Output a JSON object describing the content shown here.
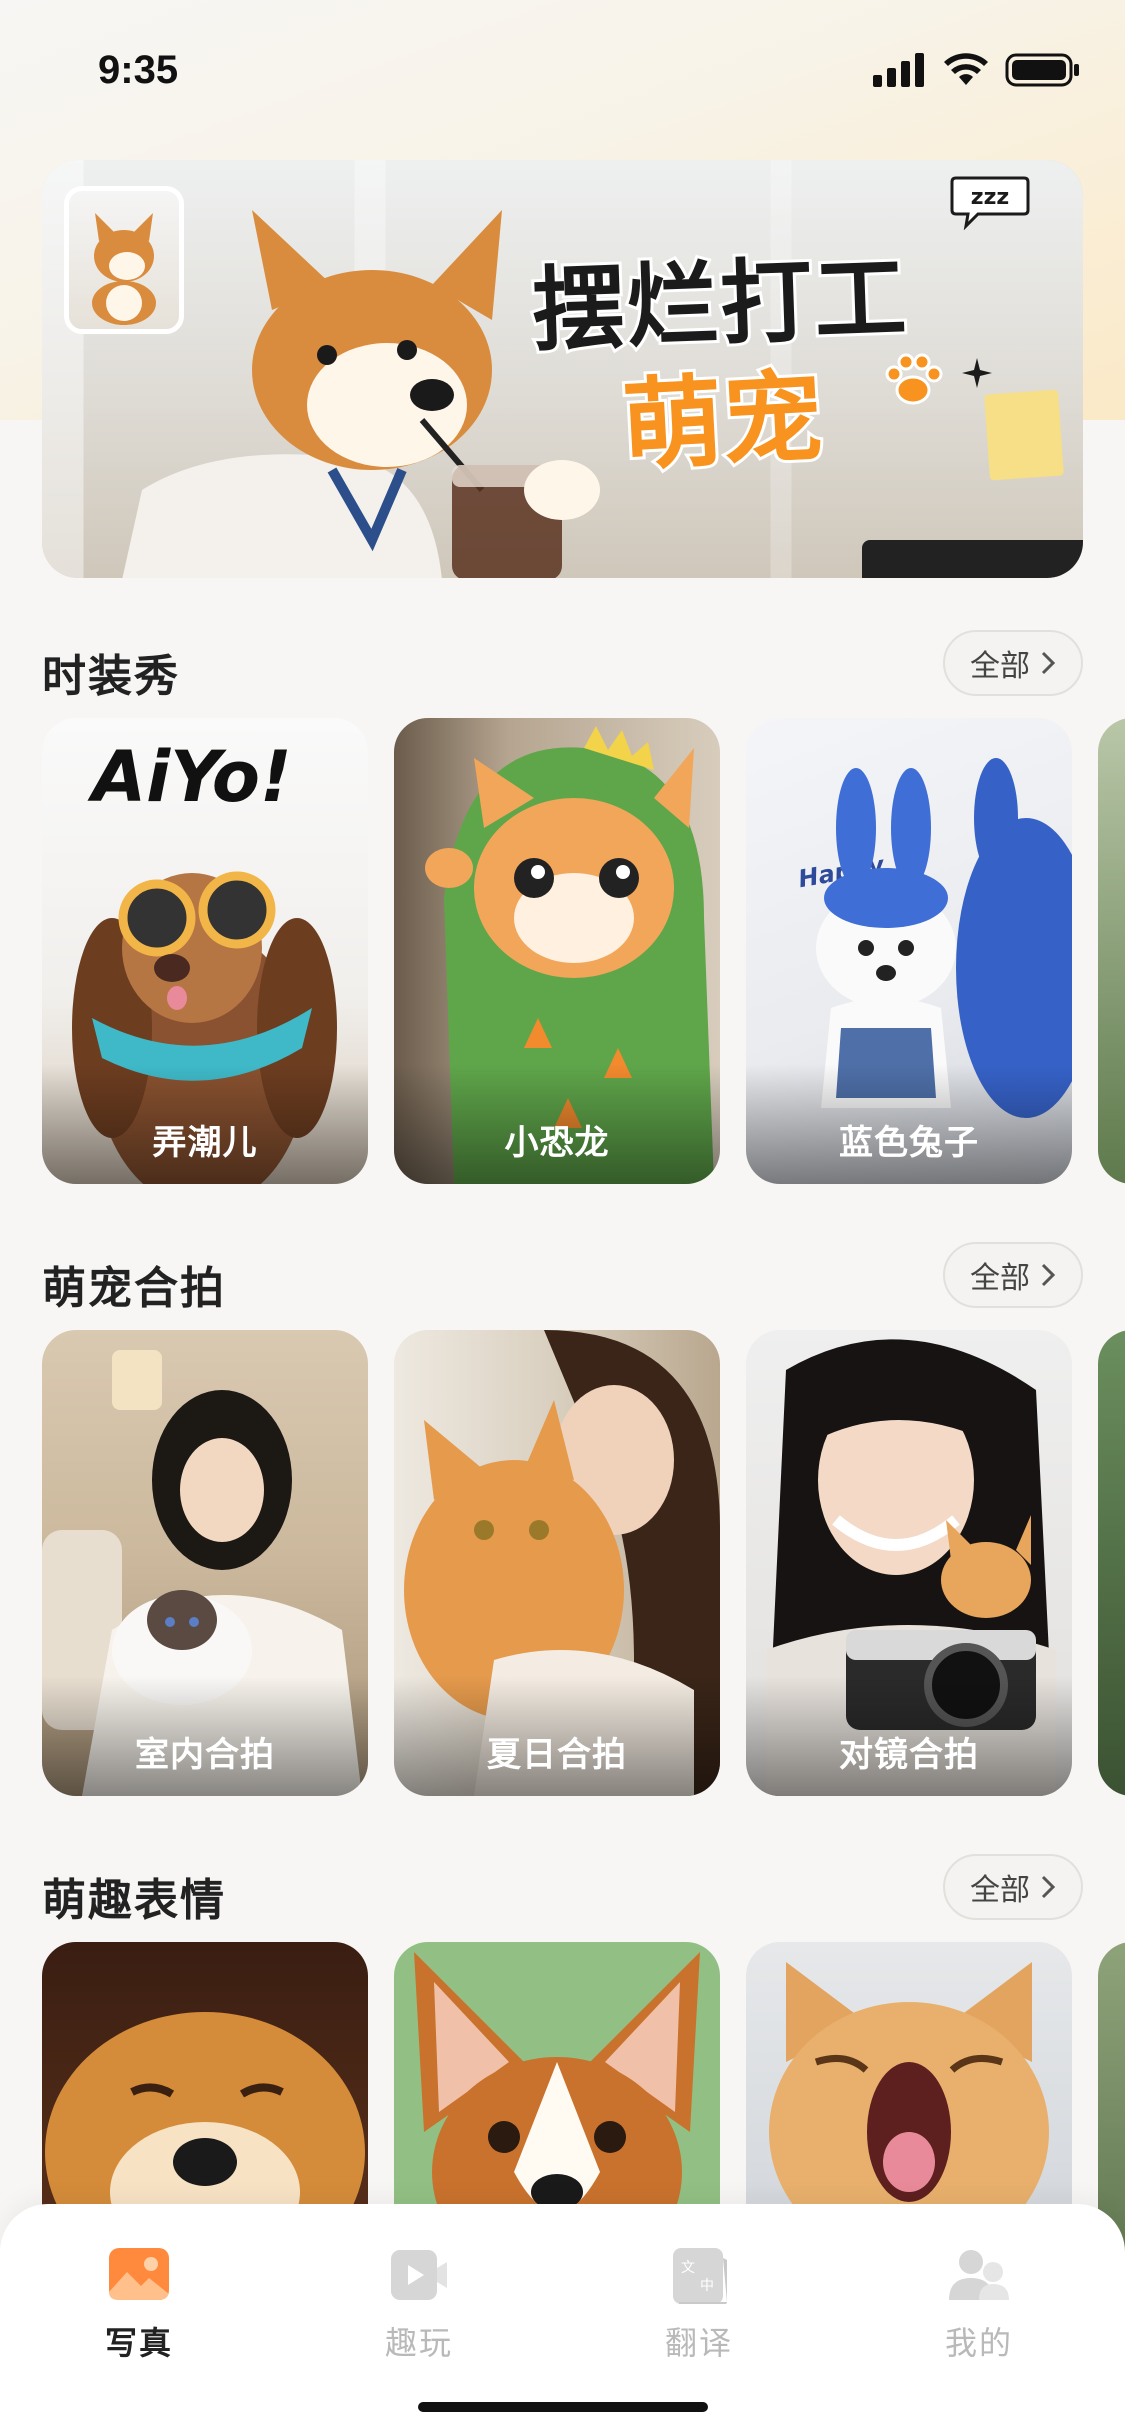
{
  "status_bar": {
    "time": "9:35"
  },
  "banner": {
    "title": "摆烂打工",
    "subtitle": "萌宠",
    "bubble_text": "zzz"
  },
  "sections": [
    {
      "title": "时装秀",
      "all_label": "全部",
      "cards": [
        {
          "label": "弄潮儿",
          "overlay_text": "AiYo!"
        },
        {
          "label": "小恐龙"
        },
        {
          "label": "蓝色兔子",
          "overlay_text": "Happy"
        }
      ]
    },
    {
      "title": "萌宠合拍",
      "all_label": "全部",
      "cards": [
        {
          "label": "室内合拍"
        },
        {
          "label": "夏日合拍"
        },
        {
          "label": "对镜合拍"
        }
      ]
    },
    {
      "title": "萌趣表情",
      "all_label": "全部",
      "cards": [
        {
          "label": ""
        },
        {
          "label": ""
        },
        {
          "label": ""
        }
      ]
    }
  ],
  "tabbar": {
    "tabs": [
      {
        "label": "写真",
        "icon": "photo-icon",
        "active": true
      },
      {
        "label": "趣玩",
        "icon": "play-video-icon",
        "active": false
      },
      {
        "label": "翻译",
        "icon": "translate-icon",
        "active": false
      },
      {
        "label": "我的",
        "icon": "profile-icon",
        "active": false
      }
    ]
  },
  "colors": {
    "accent": "#f7931e",
    "active_tab_icon": "#ff8a3d",
    "inactive": "#b9b9b9"
  }
}
